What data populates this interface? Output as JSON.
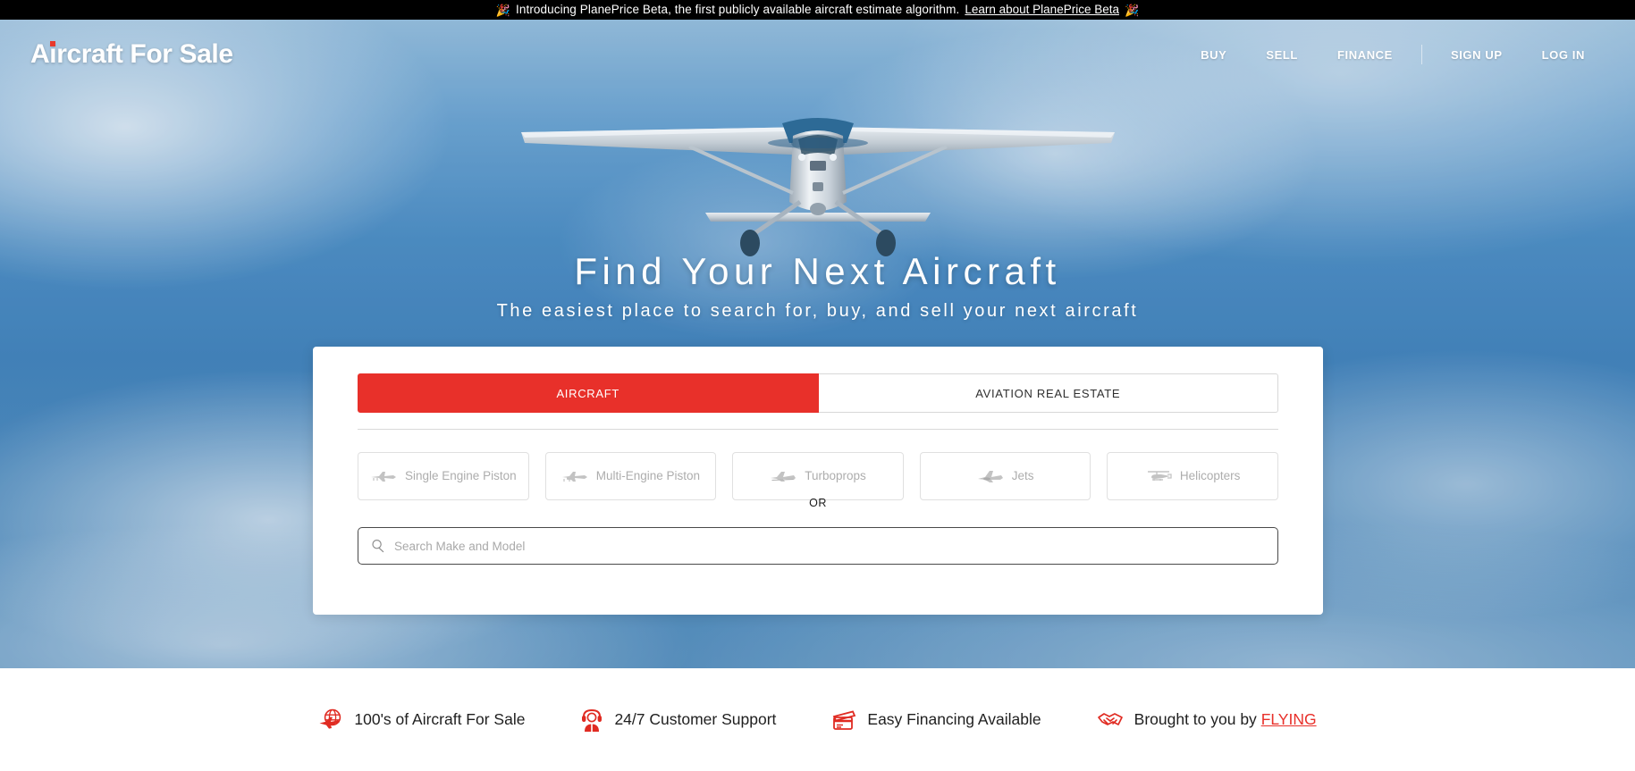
{
  "announcement": {
    "emoji_left": "🎉",
    "emoji_right": "🎉",
    "message": "Introducing PlanePrice Beta, the first publicly available aircraft estimate algorithm.",
    "link_label": "Learn about PlanePrice Beta"
  },
  "header": {
    "logo_text": "Aircraft For Sale",
    "nav": [
      {
        "label": "BUY"
      },
      {
        "label": "SELL"
      },
      {
        "label": "FINANCE"
      }
    ],
    "account": [
      {
        "label": "SIGN UP"
      },
      {
        "label": "LOG IN"
      }
    ]
  },
  "hero": {
    "title": "Find Your Next Aircraft",
    "subtitle": "The easiest place to search for, buy, and sell your next aircraft",
    "image_subject": "single-engine-high-wing-airplane-in-flight"
  },
  "search_card": {
    "tabs": [
      {
        "label": "AIRCRAFT",
        "active": true
      },
      {
        "label": "AVIATION REAL ESTATE",
        "active": false
      }
    ],
    "categories": [
      {
        "label": "Single Engine Piston",
        "icon": "single-engine-piston-icon"
      },
      {
        "label": "Multi-Engine Piston",
        "icon": "multi-engine-piston-icon"
      },
      {
        "label": "Turboprops",
        "icon": "turboprop-icon"
      },
      {
        "label": "Jets",
        "icon": "jet-icon"
      },
      {
        "label": "Helicopters",
        "icon": "helicopter-icon"
      }
    ],
    "or_label": "OR",
    "search": {
      "placeholder": "Search Make and Model",
      "value": "",
      "icon": "search-icon"
    }
  },
  "features": [
    {
      "icon": "globe-plane-icon",
      "text": "100's of Aircraft For Sale"
    },
    {
      "icon": "support-agent-icon",
      "text": "24/7 Customer Support"
    },
    {
      "icon": "credit-card-icon",
      "text": "Easy Financing Available"
    },
    {
      "icon": "handshake-icon",
      "text_prefix": "Brought to you by ",
      "link_label": "FLYING"
    }
  ],
  "colors": {
    "accent_red": "#e8302a",
    "announcement_bg": "#000000",
    "hero_sky": "#4f8cbe",
    "card_bg": "#ffffff"
  }
}
